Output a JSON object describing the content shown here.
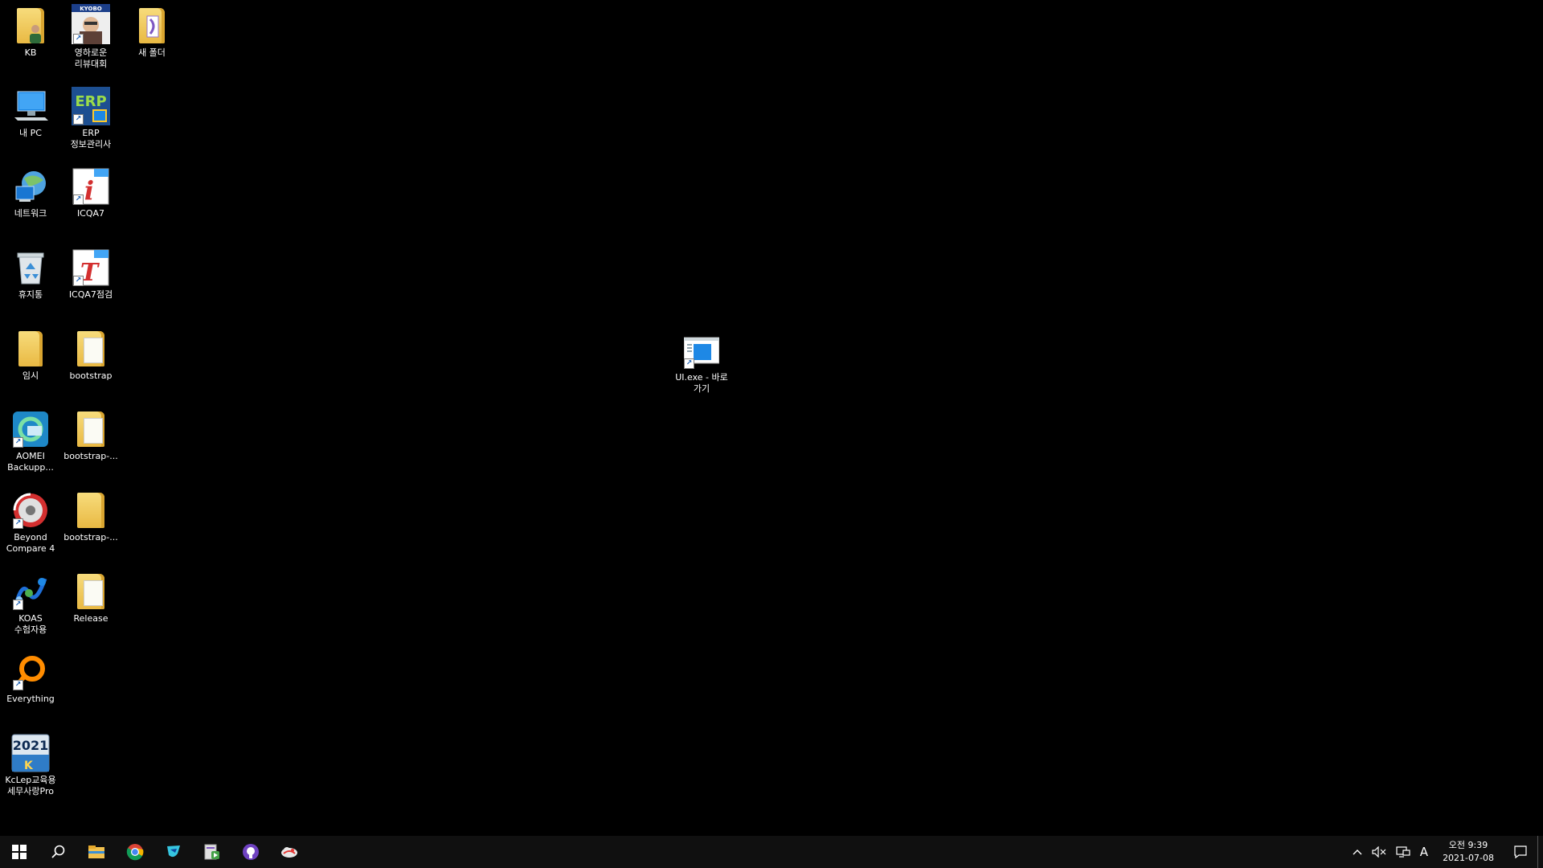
{
  "desktop": {
    "icons": [
      {
        "label": "KB",
        "icon": "folder-user-icon"
      },
      {
        "label": "영하로운\n리뷰대회",
        "icon": "kyobo-shortcut-icon"
      },
      {
        "label": "새 폴더",
        "icon": "new-folder-icon"
      },
      {
        "label": "내 PC",
        "icon": "computer-icon"
      },
      {
        "label": "ERP\n정보관리사",
        "icon": "erp-icon"
      },
      {
        "label": "네트워크",
        "icon": "network-icon"
      },
      {
        "label": "ICQA7",
        "icon": "icqa7-icon"
      },
      {
        "label": "휴지통",
        "icon": "recycle-bin-icon"
      },
      {
        "label": "ICQA7점검",
        "icon": "icqa7-check-icon"
      },
      {
        "label": "임시",
        "icon": "folder-icon"
      },
      {
        "label": "bootstrap",
        "icon": "folder-icon"
      },
      {
        "label": "AOMEI\nBackupp...",
        "icon": "aomei-backupper-icon"
      },
      {
        "label": "bootstrap-...",
        "icon": "folder-icon"
      },
      {
        "label": "Beyond\nCompare 4",
        "icon": "beyond-compare-icon"
      },
      {
        "label": "bootstrap-...",
        "icon": "folder-icon"
      },
      {
        "label": "KOAS\n수험자용",
        "icon": "koas-icon"
      },
      {
        "label": "Release",
        "icon": "folder-icon"
      },
      {
        "label": "Everything",
        "icon": "everything-search-icon"
      },
      {
        "label": "KcLep교육용\n세무사랑Pro",
        "icon": "kclep-icon"
      },
      {
        "label": "UI.exe - 바로\n가기",
        "icon": "app-shortcut-icon"
      }
    ],
    "kclep_badge": "2021"
  },
  "taskbar": {
    "pinned": [
      {
        "name": "start-button",
        "icon": "windows-logo-icon"
      },
      {
        "name": "search-button",
        "icon": "search-icon"
      },
      {
        "name": "file-explorer-button",
        "icon": "folder-icon"
      },
      {
        "name": "chrome-button",
        "icon": "chrome-icon"
      },
      {
        "name": "sourcetree-button",
        "icon": "sourcetree-icon"
      },
      {
        "name": "media-app-button",
        "icon": "document-play-icon"
      },
      {
        "name": "github-desktop-button",
        "icon": "github-icon"
      },
      {
        "name": "cloud-app-button",
        "icon": "cloud-icon"
      }
    ],
    "tray": {
      "ime": "A",
      "time": "오전 9:39",
      "date": "2021-07-08"
    }
  },
  "colors": {
    "desktop_bg": "#000000",
    "taskbar_bg": "#101010",
    "folder": "#e9b943",
    "text": "#ffffff"
  }
}
